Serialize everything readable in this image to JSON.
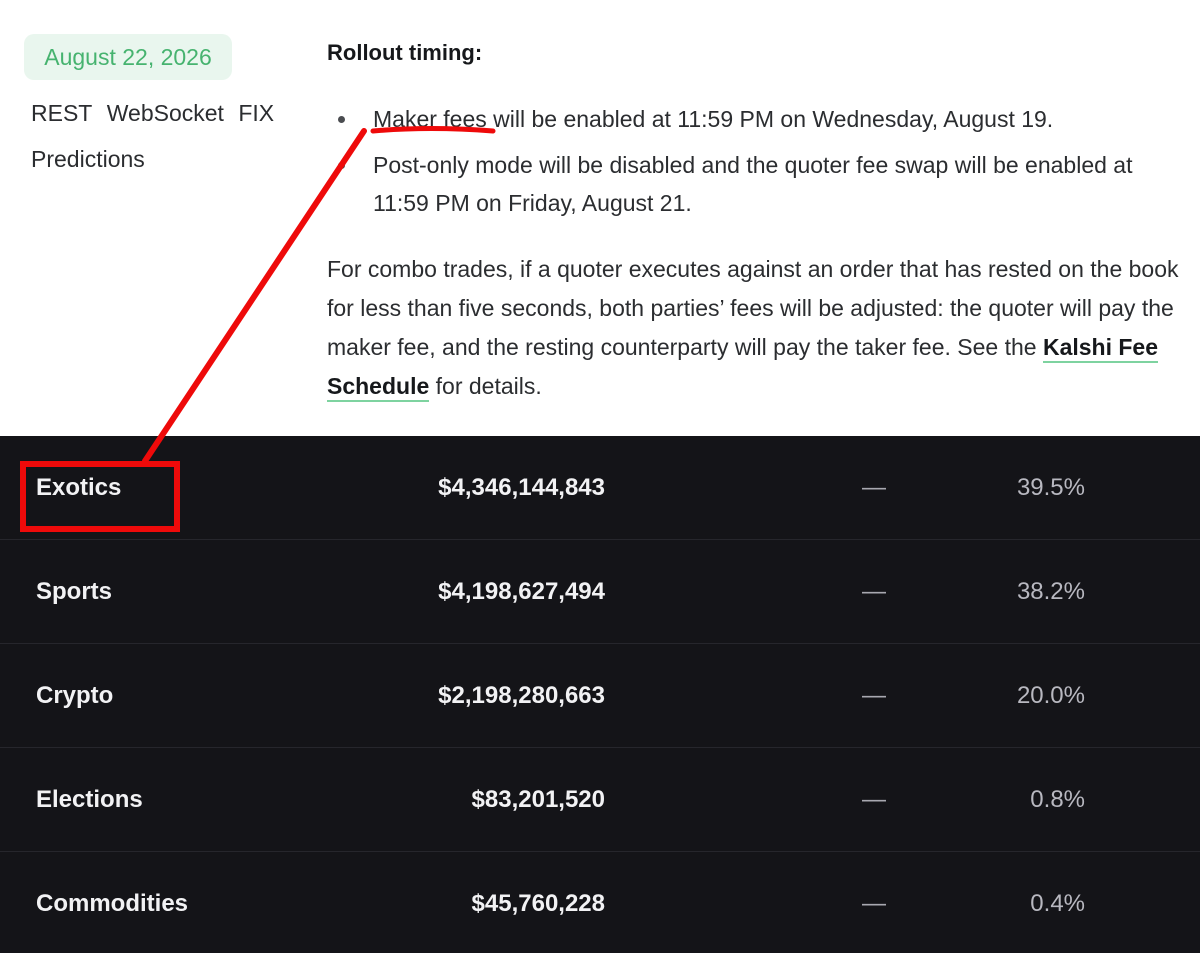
{
  "sidebar": {
    "date": "August 22, 2026",
    "tags": [
      "REST",
      "WebSocket",
      "FIX"
    ],
    "tag_predictions": "Predictions"
  },
  "changelog": {
    "heading": "Rollout timing:",
    "bullets": [
      {
        "underlined": "Maker fees",
        "rest": " will be enabled at 11:59 PM on Wednesday, August 19."
      },
      {
        "line1": "Post-only mode will be disabled and the quoter fee swap will be enabled at",
        "line2": "11:59 PM on Friday, August 21."
      }
    ],
    "paragraph": {
      "text_before": "For combo trades, if a quoter executes against an order that has rested on the book for less than five seconds, both parties’ fees will be adjusted: the quoter will pay the maker fee, and the resting counterparty will pay the taker fee. See the ",
      "link": "Kalshi Fee Schedule",
      "text_after": " for details."
    }
  },
  "table": {
    "rows": [
      {
        "category": "Exotics",
        "volume": "$4,346,144,843",
        "change": "—",
        "share": "39.5%"
      },
      {
        "category": "Sports",
        "volume": "$4,198,627,494",
        "change": "—",
        "share": "38.2%"
      },
      {
        "category": "Crypto",
        "volume": "$2,198,280,663",
        "change": "—",
        "share": "20.0%"
      },
      {
        "category": "Elections",
        "volume": "$83,201,520",
        "change": "—",
        "share": "0.8%"
      },
      {
        "category": "Commodities",
        "volume": "$45,760,228",
        "change": "—",
        "share": "0.4%"
      }
    ]
  },
  "colors": {
    "annotation": "#ee0a0a",
    "date_badge_text": "#46b36f",
    "date_badge_bg": "#e9f6ee",
    "table_bg": "#141418",
    "link_underline": "#7ed3a0"
  }
}
